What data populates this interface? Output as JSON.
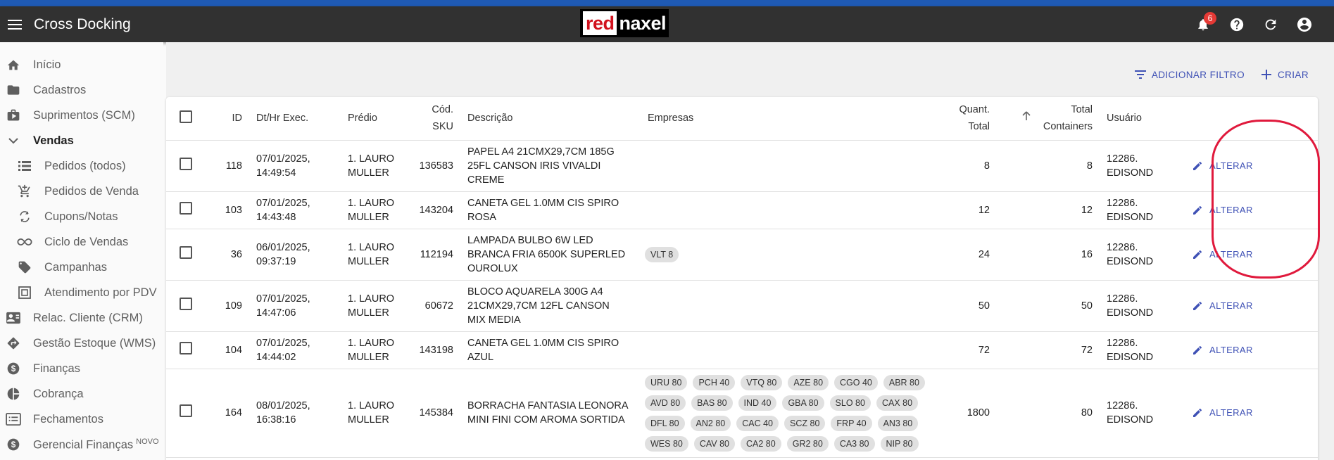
{
  "app": {
    "title": "Cross Docking",
    "logo_red": "red",
    "logo_rest": "naxel",
    "notification_count": "6"
  },
  "sidebar": {
    "items": [
      {
        "label": "Início",
        "icon": "home-icon",
        "sub": false
      },
      {
        "label": "Cadastros",
        "icon": "folder-icon",
        "sub": false
      },
      {
        "label": "Suprimentos (SCM)",
        "icon": "briefcase-icon",
        "sub": false
      },
      {
        "label": "Vendas",
        "icon": "chevron-down-icon",
        "sub": false,
        "active": true
      },
      {
        "label": "Pedidos (todos)",
        "icon": "list-icon",
        "sub": true
      },
      {
        "label": "Pedidos de Venda",
        "icon": "cart-icon",
        "sub": true
      },
      {
        "label": "Cupons/Notas",
        "icon": "receipt-cycle-icon",
        "sub": true
      },
      {
        "label": "Ciclo de Vendas",
        "icon": "infinity-icon",
        "sub": true
      },
      {
        "label": "Campanhas",
        "icon": "tag-icon",
        "sub": true
      },
      {
        "label": "Atendimento por PDV",
        "icon": "pos-icon",
        "sub": true
      },
      {
        "label": "Relac. Cliente (CRM)",
        "icon": "contact-card-icon",
        "sub": false
      },
      {
        "label": "Gestão Estoque (WMS)",
        "icon": "directions-icon",
        "sub": false
      },
      {
        "label": "Finanças",
        "icon": "dollar-icon",
        "sub": false
      },
      {
        "label": "Cobrança",
        "icon": "pie-chart-icon",
        "sub": false
      },
      {
        "label": "Fechamentos",
        "icon": "list-box-icon",
        "sub": false
      },
      {
        "label": "Gerencial Finanças",
        "icon": "dollar-icon",
        "sub": false,
        "badge": "NOVO"
      }
    ]
  },
  "toolbar": {
    "filter_label": "ADICIONAR FILTRO",
    "create_label": "CRIAR"
  },
  "table": {
    "columns": {
      "id": "ID",
      "dt": "Dt/Hr Exec.",
      "predio": "Prédio",
      "sku_1": "Cód.",
      "sku_2": "SKU",
      "descricao": "Descrição",
      "empresas": "Empresas",
      "qt_1": "Quant.",
      "qt_2": "Total",
      "tc_1": "Total",
      "tc_2": "Containers",
      "usuario": "Usuário"
    },
    "edit_label": "ALTERAR",
    "rows": [
      {
        "id": "118",
        "dt1": "07/01/2025,",
        "dt2": "14:49:54",
        "p1": "1. LAURO",
        "p2": "MULLER",
        "sku": "136583",
        "d1": "PAPEL A4 21CMX29,7CM 185G",
        "d2": "25FL CANSON IRIS VIVALDI",
        "d3": "CREME",
        "chips": [],
        "qt": "8",
        "tc": "8",
        "u1": "12286.",
        "u2": "EDISOND"
      },
      {
        "id": "103",
        "dt1": "07/01/2025,",
        "dt2": "14:43:48",
        "p1": "1. LAURO",
        "p2": "MULLER",
        "sku": "143204",
        "d1": "CANETA GEL 1.0MM CIS SPIRO",
        "d2": "ROSA",
        "d3": "",
        "chips": [],
        "qt": "12",
        "tc": "12",
        "u1": "12286.",
        "u2": "EDISOND"
      },
      {
        "id": "36",
        "dt1": "06/01/2025,",
        "dt2": "09:37:19",
        "p1": "1. LAURO",
        "p2": "MULLER",
        "sku": "112194",
        "d1": "LAMPADA BULBO 6W LED",
        "d2": "BRANCA FRIA 6500K SUPERLED",
        "d3": "OUROLUX",
        "chips": [
          "VLT 8"
        ],
        "qt": "24",
        "tc": "16",
        "u1": "12286.",
        "u2": "EDISOND"
      },
      {
        "id": "109",
        "dt1": "07/01/2025,",
        "dt2": "14:47:06",
        "p1": "1. LAURO",
        "p2": "MULLER",
        "sku": "60672",
        "d1": "BLOCO AQUARELA 300G A4",
        "d2": "21CMX29,7CM 12FL CANSON",
        "d3": "MIX MEDIA",
        "chips": [],
        "qt": "50",
        "tc": "50",
        "u1": "12286.",
        "u2": "EDISOND"
      },
      {
        "id": "104",
        "dt1": "07/01/2025,",
        "dt2": "14:44:02",
        "p1": "1. LAURO",
        "p2": "MULLER",
        "sku": "143198",
        "d1": "CANETA GEL 1.0MM CIS SPIRO",
        "d2": "AZUL",
        "d3": "",
        "chips": [],
        "qt": "72",
        "tc": "72",
        "u1": "12286.",
        "u2": "EDISOND"
      },
      {
        "id": "164",
        "dt1": "08/01/2025,",
        "dt2": "16:38:16",
        "p1": "1. LAURO",
        "p2": "MULLER",
        "sku": "145384",
        "d1": "BORRACHA FANTASIA LEONORA",
        "d2": "MINI FINI COM AROMA SORTIDA",
        "d3": "",
        "chips": [
          "URU 80",
          "PCH 40",
          "VTQ 80",
          "AZE 80",
          "CGO 40",
          "ABR 80",
          "AVD 80",
          "BAS 80",
          "IND 40",
          "GBA 80",
          "SLO 80",
          "CAX 80",
          "DFL 80",
          "AN2 80",
          "CAC 40",
          "SCZ 80",
          "FRP 40",
          "AN3 80",
          "WES 80",
          "CAV 80",
          "CA2 80",
          "GR2 80",
          "CA3 80",
          "NIP 80"
        ],
        "qt": "1800",
        "tc": "80",
        "u1": "12286.",
        "u2": "EDISOND"
      }
    ]
  }
}
